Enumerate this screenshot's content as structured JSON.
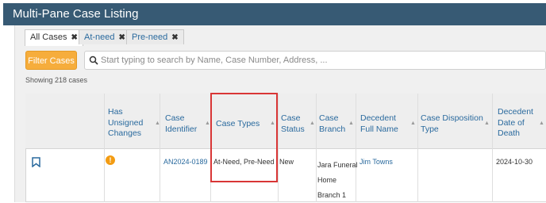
{
  "window": {
    "title": "Multi-Pane Case Listing"
  },
  "tabs": [
    {
      "label": "All Cases",
      "close": "✖"
    },
    {
      "label": "At-need",
      "close": "✖"
    },
    {
      "label": "Pre-need",
      "close": "✖"
    }
  ],
  "toolbar": {
    "filter_label": "Filter Cases",
    "search_placeholder": "Start typing to search by Name, Case Number, Address, ..."
  },
  "summary": {
    "showing": "Showing 218 cases"
  },
  "table": {
    "headers": {
      "unsigned": [
        "Has",
        "Unsigned",
        "Changes"
      ],
      "case_identifier": [
        "Case",
        "Identifier"
      ],
      "case_types": [
        "Case Types"
      ],
      "case_status": [
        "Case",
        "Status"
      ],
      "case_branch": [
        "Case",
        "Branch"
      ],
      "decedent_name": [
        "Decedent",
        "Full Name"
      ],
      "disposition": [
        "Case Disposition",
        "Type"
      ],
      "date_of_death": [
        "Decedent",
        "Date of",
        "Death"
      ]
    },
    "rows": [
      {
        "unsigned_icon": "warning-icon",
        "case_identifier": "AN2024-0189",
        "case_types": "At-Need, Pre-Need",
        "case_status": "New",
        "case_branch": [
          "Jara Funeral",
          "Home",
          "Branch 1"
        ],
        "decedent_name": "Jim Towns",
        "disposition": "",
        "date_of_death": "2024-10-30"
      }
    ]
  },
  "colors": {
    "titlebar": "#375a74",
    "accent": "#f6ad3c",
    "link": "#2a6a9e",
    "highlight": "#d93636"
  },
  "icons": {
    "bookmark": "bookmark-icon",
    "search": "search-icon",
    "sort": "sort-icon",
    "warning": "warning-icon"
  }
}
